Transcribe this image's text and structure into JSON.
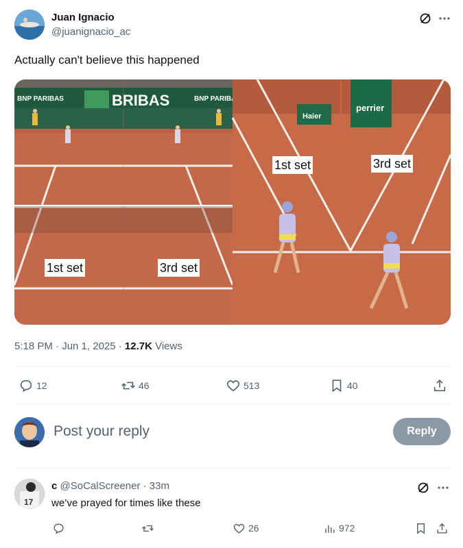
{
  "post": {
    "author_name": "Juan Ignacio",
    "author_handle": "@juanignacio_ac",
    "text": "Actually can't believe this happened",
    "timestamp": "5:18 PM · Jun 1, 2025 · ",
    "views_count": "12.7K",
    "views_label": " Views",
    "media": {
      "labels": [
        "1st set",
        "3rd set",
        "1st set",
        "3rd set"
      ],
      "sponsor_text": [
        "BNP PARIBAS",
        "BRIBAS",
        "BNP PARIBAS",
        "Haier",
        "perrier"
      ]
    },
    "actions": {
      "replies": "12",
      "reposts": "46",
      "likes": "513",
      "bookmarks": "40"
    }
  },
  "reply_composer": {
    "placeholder": "Post your reply",
    "button_label": "Reply"
  },
  "comment": {
    "name": "c",
    "handle": "@SoCalScreener",
    "time": " · 33m",
    "text": "we’ve prayed for times like these",
    "likes": "26",
    "views": "972"
  },
  "colors": {
    "text_primary": "#0f1419",
    "text_secondary": "#536471",
    "divider": "#eff3f4",
    "reply_button": "#8b98a5",
    "clay": "#c26a4c"
  },
  "icons": [
    "grok-icon",
    "more-icon",
    "reply-icon",
    "repost-icon",
    "like-icon",
    "bookmark-icon",
    "share-icon",
    "views-icon"
  ]
}
